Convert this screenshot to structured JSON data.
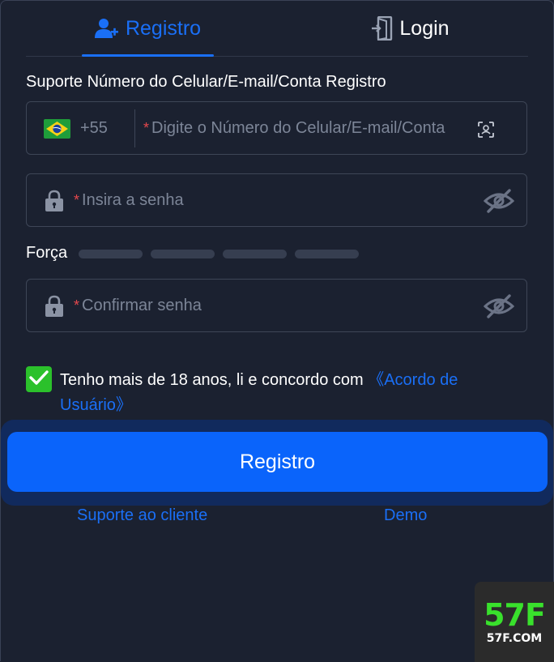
{
  "tabs": {
    "register_label": "Registro",
    "login_label": "Login"
  },
  "form": {
    "section_label": "Suporte Número do Celular/E-mail/Conta Registro",
    "phone": {
      "country_code": "+55",
      "required_mark": "*",
      "placeholder": "Digite o Número do Celular/E-mail/Conta"
    },
    "password": {
      "required_mark": "*",
      "placeholder": "Insira a senha"
    },
    "strength_label": "Força",
    "confirm": {
      "required_mark": "*",
      "placeholder": "Confirmar senha"
    },
    "agreement": {
      "checked": true,
      "text": "Tenho mais de 18 anos, li e concordo com ",
      "link": "《Acordo de Usuário》"
    },
    "submit_label": "Registro"
  },
  "footer": {
    "support_link": "Suporte ao cliente",
    "demo_link": "Demo"
  },
  "brand": {
    "logo_text": "57F",
    "domain": "57F.COM"
  },
  "colors": {
    "accent": "#0a64fb",
    "link": "#1a6ff6",
    "background": "#1b2130",
    "checkbox": "#2bc12b",
    "required": "#e5484d"
  }
}
